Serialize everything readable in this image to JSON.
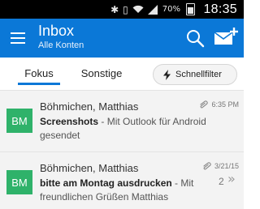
{
  "status_bar": {
    "battery_percent": "70%",
    "time": "18:35",
    "icons": [
      "bluetooth-icon",
      "vibrate-icon",
      "wifi-icon",
      "signal-icon",
      "battery-icon"
    ]
  },
  "app_bar": {
    "title": "Inbox",
    "subtitle": "Alle Konten",
    "icons": [
      "menu-icon",
      "search-icon",
      "compose-mail-icon"
    ]
  },
  "tabs": {
    "items": [
      {
        "label": "Fokus",
        "selected": true
      },
      {
        "label": "Sonstige",
        "selected": false
      }
    ],
    "filter_label": "Schnellfilter"
  },
  "messages": [
    {
      "avatar_initials": "BM",
      "avatar_color": "#2fb26a",
      "sender": "Böhmichen, Matthias",
      "subject": "Screenshots",
      "separator": " - ",
      "snippet": "Mit Outlook für Android gesendet",
      "time": "6:35 PM",
      "has_attachment": true
    },
    {
      "avatar_initials": "BM",
      "avatar_color": "#2fb26a",
      "sender": "Böhmichen, Matthias",
      "subject": "bitte am Montag ausdrucken",
      "separator": " - ",
      "snippet": "Mit freundlichen Grüßen Matthias",
      "time": "3/21/15",
      "has_attachment": true,
      "thread_count": "2"
    }
  ],
  "colors": {
    "accent": "#0b78d7",
    "avatar": "#2fb26a",
    "list_background": "#f3f3f3"
  }
}
